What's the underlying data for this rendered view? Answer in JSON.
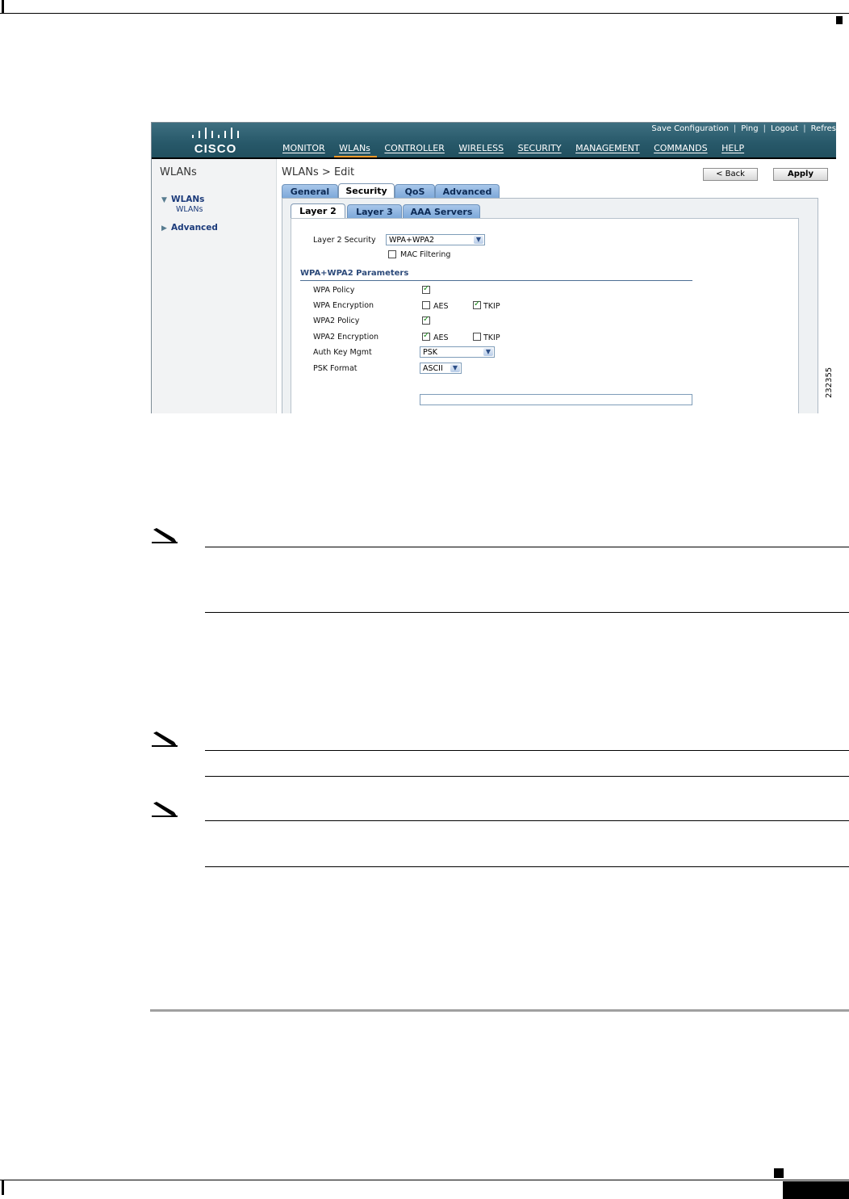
{
  "banner": {
    "logo_text": "CISCO",
    "top_links": [
      "Save Configuration",
      "Ping",
      "Logout",
      "Refres"
    ],
    "nav": [
      "MONITOR",
      "WLANs",
      "CONTROLLER",
      "WIRELESS",
      "SECURITY",
      "MANAGEMENT",
      "COMMANDS",
      "HELP"
    ],
    "active_nav": "WLANs"
  },
  "left": {
    "title": "WLANs",
    "items": [
      {
        "label": "WLANs",
        "expanded": true,
        "children": [
          "WLANs"
        ]
      },
      {
        "label": "Advanced",
        "expanded": false,
        "children": []
      }
    ]
  },
  "content": {
    "title": "WLANs > Edit",
    "back_label": "< Back",
    "apply_label": "Apply",
    "tabs": [
      "General",
      "Security",
      "QoS",
      "Advanced"
    ],
    "active_tab": "Security",
    "subtabs": [
      "Layer 2",
      "Layer 3",
      "AAA Servers"
    ],
    "active_subtab": "Layer 2",
    "layer2_security_label": "Layer 2 Security",
    "layer2_security_value": "WPA+WPA2",
    "mac_filtering_label": "MAC Filtering",
    "section_title": "WPA+WPA2 Parameters",
    "wpa_policy_label": "WPA Policy",
    "wpa_encryption_label": "WPA Encryption",
    "wpa2_policy_label": "WPA2 Policy",
    "wpa2_encryption_label": "WPA2 Encryption",
    "aes_label": "AES",
    "tkip_label": "TKIP",
    "auth_key_label": "Auth Key Mgmt",
    "auth_key_value": "PSK",
    "psk_format_label": "PSK Format",
    "psk_format_value": "ASCII"
  },
  "figure_number": "232355",
  "colors": {
    "banner": "#275869",
    "tab": "#7aa6d8",
    "active_underline": "#f09a2a"
  }
}
